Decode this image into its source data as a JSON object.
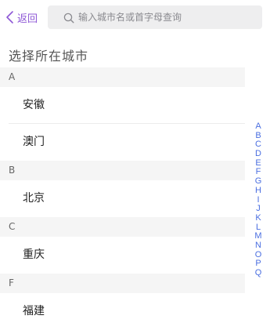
{
  "header": {
    "back_label": "返回",
    "search_placeholder": "输入城市名或首字母查询"
  },
  "page_title": "选择所在城市",
  "sections": [
    {
      "letter": "A",
      "cities": [
        "安徽",
        "澳门"
      ]
    },
    {
      "letter": "B",
      "cities": [
        "北京"
      ]
    },
    {
      "letter": "C",
      "cities": [
        "重庆"
      ]
    },
    {
      "letter": "F",
      "cities": [
        "福建"
      ]
    }
  ],
  "index_letters": [
    "A",
    "B",
    "C",
    "D",
    "E",
    "F",
    "G",
    "H",
    "I",
    "J",
    "K",
    "L",
    "M",
    "N",
    "O",
    "P",
    "Q"
  ],
  "colors": {
    "accent": "#8e58d6",
    "index": "#4a6ee0",
    "section_bg": "#f5f5f5",
    "search_bg": "#eeeeef"
  },
  "icons": {
    "back": "chevron-left-icon",
    "search": "search-icon"
  }
}
